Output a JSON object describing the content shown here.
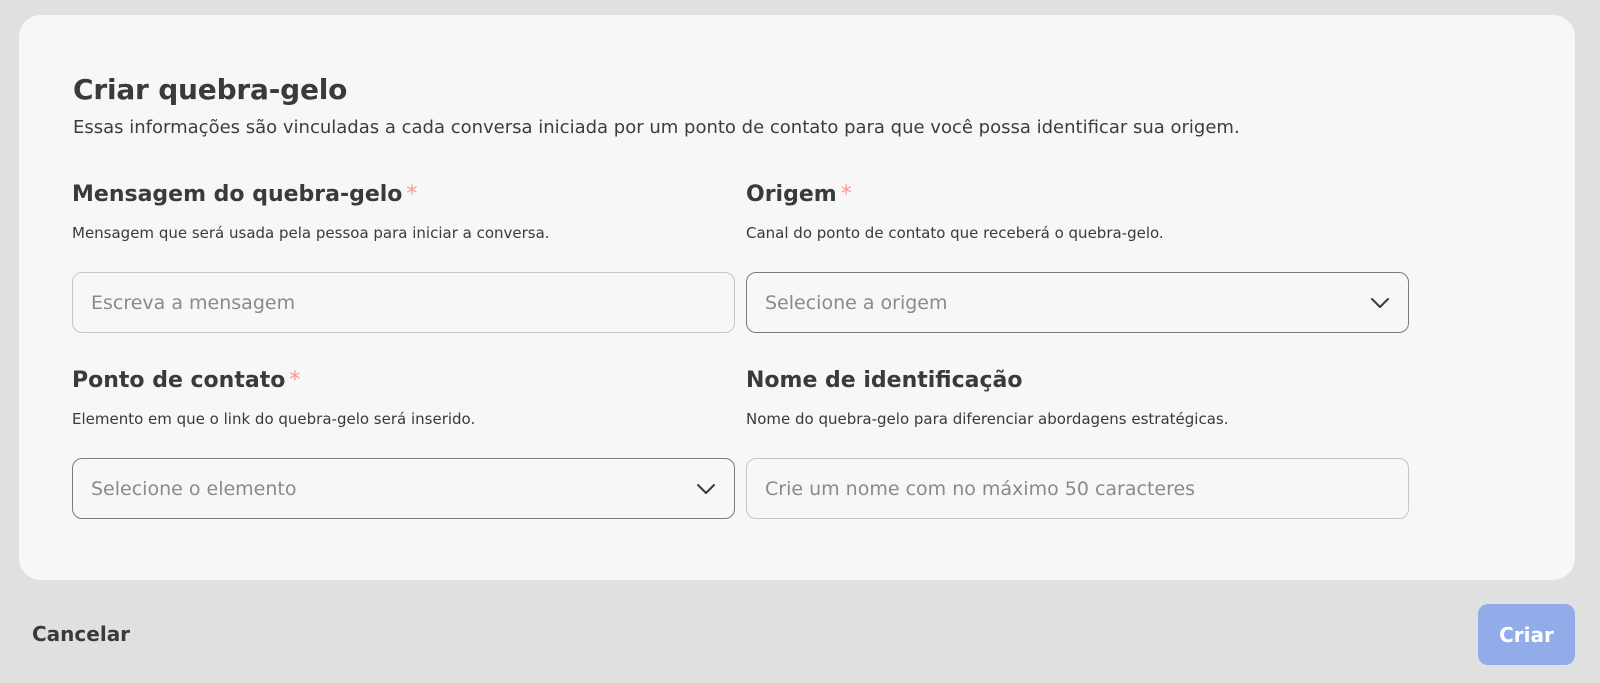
{
  "header": {
    "title": "Criar quebra-gelo",
    "subtitle": "Essas informações são vinculadas a cada conversa iniciada por um ponto de contato para que você possa identificar sua origem."
  },
  "fields": {
    "message": {
      "label": "Mensagem do quebra-gelo",
      "required_mark": "*",
      "help": "Mensagem que será usada pela pessoa para iniciar a conversa.",
      "placeholder": "Escreva a mensagem",
      "value": ""
    },
    "origin": {
      "label": "Origem",
      "required_mark": "*",
      "help": "Canal do ponto de contato que receberá o quebra-gelo.",
      "placeholder": "Selecione a origem",
      "icon": "chevron-down-icon"
    },
    "contact_point": {
      "label": "Ponto de contato",
      "required_mark": "*",
      "help": "Elemento em que o link do quebra-gelo será inserido.",
      "placeholder": "Selecione o elemento",
      "icon": "chevron-down-icon"
    },
    "identification_name": {
      "label": "Nome de identificação",
      "help": "Nome do quebra-gelo para diferenciar abordagens estratégicas.",
      "placeholder": "Crie um nome com no máximo 50 caracteres",
      "value": ""
    }
  },
  "footer": {
    "cancel_label": "Cancelar",
    "create_label": "Criar"
  },
  "colors": {
    "background": "#e0e0e0",
    "card": "#f7f7f7",
    "required": "#ee9a98",
    "primary_disabled": "#91ace8"
  }
}
